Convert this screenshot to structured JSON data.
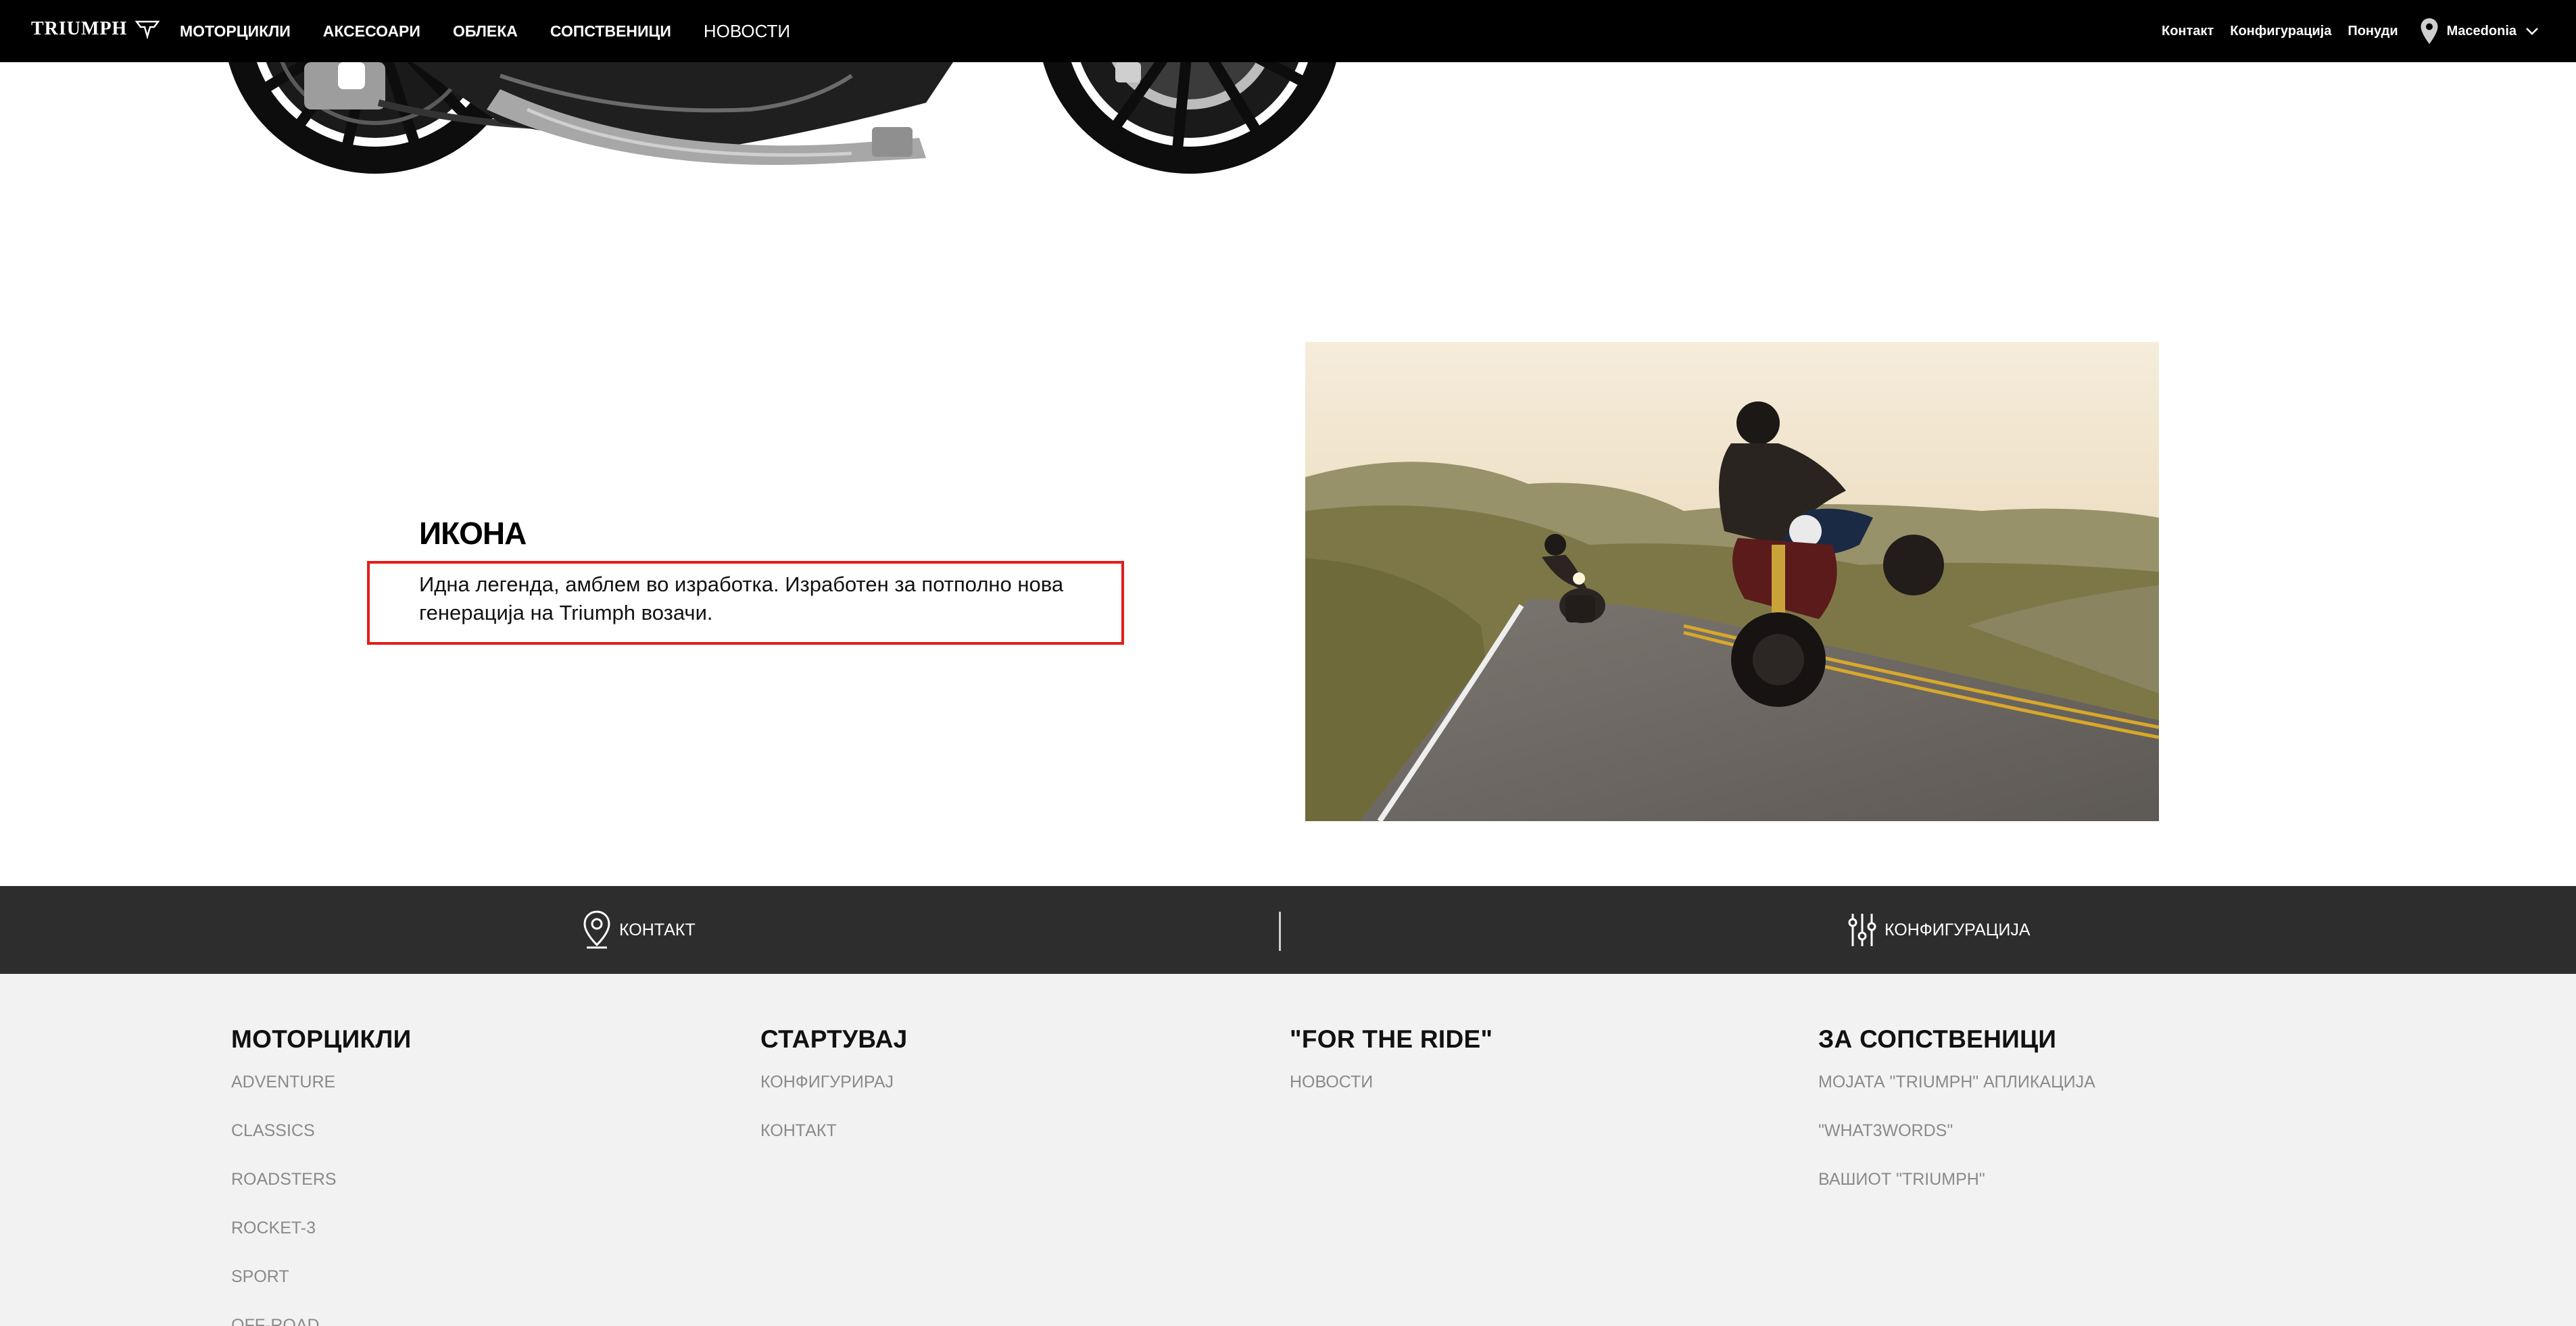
{
  "header": {
    "logo_text": "TRIUMPH",
    "nav": [
      "МОТОРЦИКЛИ",
      "АКСЕСОАРИ",
      "ОБЛЕКА",
      "СОПСТВЕНИЦИ",
      "НОВОСТИ"
    ],
    "util": [
      "Контакт",
      "Конфигурација",
      "Понуди"
    ],
    "region": "Macedonia",
    "icons": {
      "region": "location-pin-icon",
      "dropdown": "chevron-down-icon"
    }
  },
  "feature": {
    "title": "ИКОНА",
    "text": "Идна легенда, амблем во изработка. Изработен за потполно нова генерација на Triumph возачи.",
    "highlight_color": "#e31d1d"
  },
  "cta": {
    "contact": "КОНТАКТ",
    "configure": "КОНФИГУРАЦИЈА",
    "icons": {
      "contact": "location-pin-icon",
      "configure": "sliders-icon"
    }
  },
  "footer": {
    "columns": [
      {
        "title": "МОТОРЦИКЛИ",
        "links": [
          "ADVENTURE",
          "CLASSICS",
          "ROADSTERS",
          "ROCKET-3",
          "SPORT",
          "OFF-ROAD"
        ]
      },
      {
        "title": "СТАРТУВАЈ",
        "links": [
          "КОНФИГУРИРАЈ",
          "КОНТАКТ"
        ]
      },
      {
        "title": "\"FOR THE RIDE\"",
        "links": [
          "НОВОСТИ"
        ]
      },
      {
        "title": "ЗА СОПСТВЕНИЦИ",
        "links": [
          "МОЈАТА \"TRIUMPH\" АПЛИКАЦИЈА",
          "\"WHAT3WORDS\"",
          "ВАШИОТ \"TRIUMPH\""
        ]
      }
    ]
  },
  "colors": {
    "header_bg": "#000000",
    "cta_bg": "#2d2d2d",
    "footer_bg": "#f2f2f2",
    "footer_link": "#8a8a8a"
  }
}
